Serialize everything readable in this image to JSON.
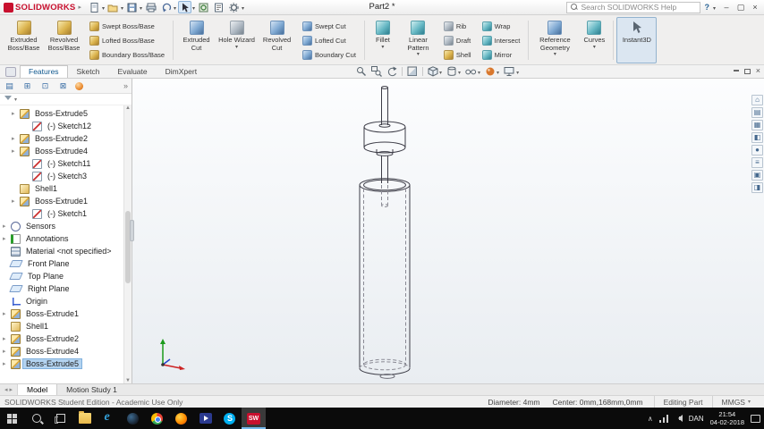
{
  "titlebar": {
    "brand": "SOLIDWORKS",
    "document_title": "Part2 *",
    "search_placeholder": "Search SOLIDWORKS Help"
  },
  "command_tabs": {
    "items": [
      {
        "label": "Features"
      },
      {
        "label": "Sketch"
      },
      {
        "label": "Evaluate"
      },
      {
        "label": "DimXpert"
      }
    ]
  },
  "ribbon": {
    "extruded_boss": "Extruded Boss/Base",
    "revolved_boss": "Revolved Boss/Base",
    "swept_boss": "Swept Boss/Base",
    "lofted_boss": "Lofted Boss/Base",
    "boundary_boss": "Boundary Boss/Base",
    "extruded_cut": "Extruded Cut",
    "hole_wizard": "Hole Wizard",
    "revolved_cut": "Revolved Cut",
    "swept_cut": "Swept Cut",
    "lofted_cut": "Lofted Cut",
    "boundary_cut": "Boundary Cut",
    "fillet": "Fillet",
    "linear_pattern": "Linear Pattern",
    "rib": "Rib",
    "draft": "Draft",
    "shell": "Shell",
    "wrap": "Wrap",
    "intersect": "Intersect",
    "mirror": "Mirror",
    "reference_geometry": "Reference Geometry",
    "curves": "Curves",
    "instant3d": "Instant3D"
  },
  "feature_tree": {
    "items": [
      {
        "label": "Boss-Extrude5",
        "icon": "boss-extrude",
        "indent": 1,
        "expandable": true
      },
      {
        "label": "(-) Sketch12",
        "icon": "sketch",
        "indent": 2,
        "expandable": false
      },
      {
        "label": "Boss-Extrude2",
        "icon": "boss-extrude",
        "indent": 1,
        "expandable": true
      },
      {
        "label": "Boss-Extrude4",
        "icon": "boss-extrude",
        "indent": 1,
        "expandable": true
      },
      {
        "label": "(-) Sketch11",
        "icon": "sketch",
        "indent": 2,
        "expandable": false
      },
      {
        "label": "(-) Sketch3",
        "icon": "sketch",
        "indent": 2,
        "expandable": false
      },
      {
        "label": "Shell1",
        "icon": "shell",
        "indent": 1,
        "expandable": false
      },
      {
        "label": "Boss-Extrude1",
        "icon": "boss-extrude",
        "indent": 1,
        "expandable": true
      },
      {
        "label": "(-) Sketch1",
        "icon": "sketch",
        "indent": 2,
        "expandable": false
      },
      {
        "label": "Sensors",
        "icon": "sensors",
        "indent": 0,
        "expandable": true
      },
      {
        "label": "Annotations",
        "icon": "annotations",
        "indent": 0,
        "expandable": true
      },
      {
        "label": "Material <not specified>",
        "icon": "material",
        "indent": 0,
        "expandable": false
      },
      {
        "label": "Front Plane",
        "icon": "plane",
        "indent": 0,
        "expandable": false
      },
      {
        "label": "Top Plane",
        "icon": "plane",
        "indent": 0,
        "expandable": false
      },
      {
        "label": "Right Plane",
        "icon": "plane",
        "indent": 0,
        "expandable": false
      },
      {
        "label": "Origin",
        "icon": "origin",
        "indent": 0,
        "expandable": false
      },
      {
        "label": "Boss-Extrude1",
        "icon": "boss-extrude",
        "indent": 0,
        "expandable": true
      },
      {
        "label": "Shell1",
        "icon": "shell",
        "indent": 0,
        "expandable": false
      },
      {
        "label": "Boss-Extrude2",
        "icon": "boss-extrude",
        "indent": 0,
        "expandable": true
      },
      {
        "label": "Boss-Extrude4",
        "icon": "boss-extrude",
        "indent": 0,
        "expandable": true
      },
      {
        "label": "Boss-Extrude5",
        "icon": "boss-extrude",
        "indent": 0,
        "expandable": true,
        "selected": true
      }
    ]
  },
  "doc_tabs": {
    "model": "Model",
    "motion_study": "Motion Study 1"
  },
  "statusbar": {
    "left": "SOLIDWORKS Student Edition - Academic Use Only",
    "diameter": "Diameter: 4mm",
    "center": "Center: 0mm,168mm,0mm",
    "mode": "Editing Part",
    "units": "MMGS"
  },
  "taskbar": {
    "language": "DAN",
    "time": "21:54",
    "date": "04-02-2018",
    "solidworks_glyph": "SW",
    "icons": [
      "start",
      "search",
      "task-view",
      "file-explorer",
      "edge",
      "steam",
      "chrome",
      "firefox",
      "media-player",
      "skype",
      "solidworks"
    ]
  }
}
